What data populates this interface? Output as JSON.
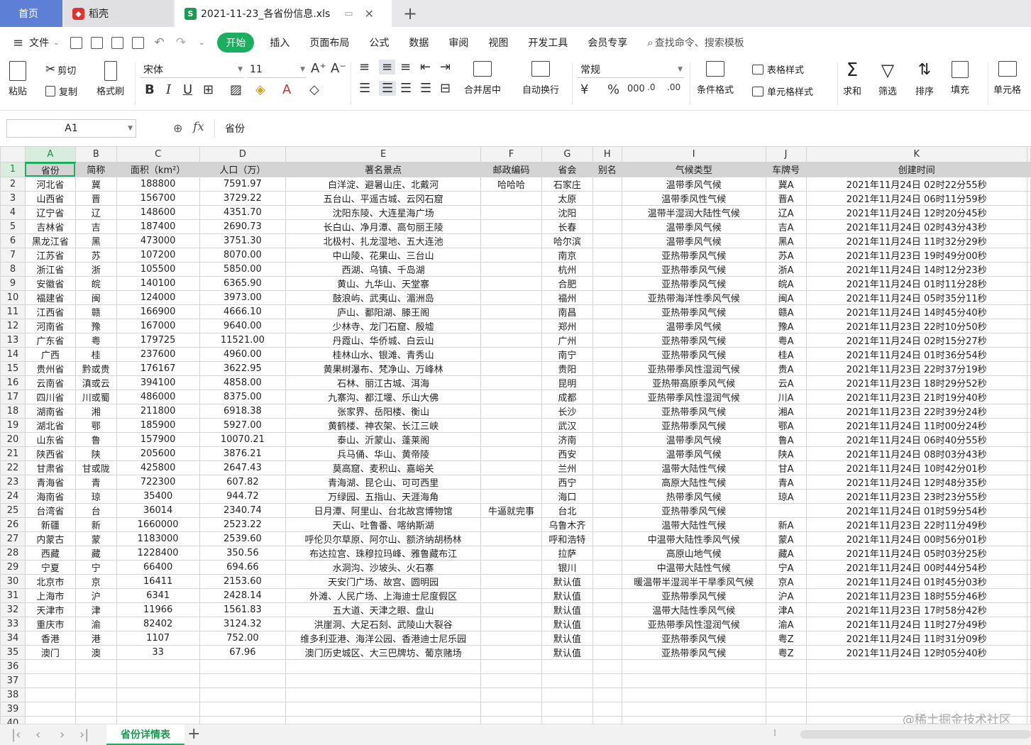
{
  "tabs": {
    "home": "首页",
    "daoke": "稻壳",
    "file": "2021-11-23_各省份信息.xls"
  },
  "menu": {
    "file": "文件",
    "items": [
      "开始",
      "插入",
      "页面布局",
      "公式",
      "数据",
      "审阅",
      "视图",
      "开发工具",
      "会员专享"
    ],
    "search": "查找命令、搜索模板"
  },
  "ribbon": {
    "paste": "粘贴",
    "cut": "剪切",
    "copy": "复制",
    "format_painter": "格式刷",
    "font_name": "宋体",
    "font_size": "11",
    "merge_center": "合并居中",
    "wrap": "自动换行",
    "number_format": "常规",
    "cond_format": "条件格式",
    "table_style": "表格样式",
    "cell_style": "单元格样式",
    "sum": "求和",
    "filter": "筛选",
    "sort": "排序",
    "fill": "填充",
    "cell": "单元格"
  },
  "formula": {
    "cell_ref": "A1",
    "fx": "fx",
    "content": "省份"
  },
  "columns": [
    "A",
    "B",
    "C",
    "D",
    "E",
    "F",
    "G",
    "H",
    "I",
    "J",
    "K"
  ],
  "header": [
    "省份",
    "简称",
    "面积（km²）",
    "人口（万）",
    "著名景点",
    "邮政编码",
    "省会",
    "别名",
    "气候类型",
    "车牌号",
    "创建时间"
  ],
  "rows": [
    [
      "河北省",
      "冀",
      "188800",
      "7591.97",
      "白洋淀、避暑山庄、北戴河",
      "哈哈哈",
      "石家庄",
      "",
      "温带季风气候",
      "冀A",
      "2021年11月24日 02时22分55秒"
    ],
    [
      "山西省",
      "晋",
      "156700",
      "3729.22",
      "五台山、平遥古城、云冈石窟",
      "",
      "太原",
      "",
      "温带季风性气候",
      "晋A",
      "2021年11月24日 06时11分59秒"
    ],
    [
      "辽宁省",
      "辽",
      "148600",
      "4351.70",
      "沈阳东陵、大连星海广场",
      "",
      "沈阳",
      "",
      "温带半湿润大陆性气候",
      "辽A",
      "2021年11月24日 12时20分45秒"
    ],
    [
      "吉林省",
      "吉",
      "187400",
      "2690.73",
      "长白山、净月潭、高句丽王陵",
      "",
      "长春",
      "",
      "温带季风气候",
      "吉A",
      "2021年11月24日 02时43分43秒"
    ],
    [
      "黑龙江省",
      "黑",
      "473000",
      "3751.30",
      "北极村、扎龙湿地、五大连池",
      "",
      "哈尔滨",
      "",
      "温带季风气候",
      "黑A",
      "2021年11月24日 11时32分29秒"
    ],
    [
      "江苏省",
      "苏",
      "107200",
      "8070.00",
      "中山陵、花果山、三台山",
      "",
      "南京",
      "",
      "亚热带季风气候",
      "苏A",
      "2021年11月23日 19时49分00秒"
    ],
    [
      "浙江省",
      "浙",
      "105500",
      "5850.00",
      "西湖、乌镇、千岛湖",
      "",
      "杭州",
      "",
      "亚热带季风气候",
      "浙A",
      "2021年11月24日 14时12分23秒"
    ],
    [
      "安徽省",
      "皖",
      "140100",
      "6365.90",
      "黄山、九华山、天堂寨",
      "",
      "合肥",
      "",
      "亚热带季风气候",
      "皖A",
      "2021年11月24日 01时11分28秒"
    ],
    [
      "福建省",
      "闽",
      "124000",
      "3973.00",
      "鼓浪屿、武夷山、湄洲岛",
      "",
      "福州",
      "",
      "亚热带海洋性季风气候",
      "闽A",
      "2021年11月24日 05时35分11秒"
    ],
    [
      "江西省",
      "赣",
      "166900",
      "4666.10",
      "庐山、鄱阳湖、滕王阁",
      "",
      "南昌",
      "",
      "亚热带季风气候",
      "赣A",
      "2021年11月24日 14时45分40秒"
    ],
    [
      "河南省",
      "豫",
      "167000",
      "9640.00",
      "少林寺、龙门石窟、殷墟",
      "",
      "郑州",
      "",
      "温带季风气候",
      "豫A",
      "2021年11月23日 22时10分50秒"
    ],
    [
      "广东省",
      "粤",
      "179725",
      "11521.00",
      "丹霞山、华侨城、白云山",
      "",
      "广州",
      "",
      "亚热带季风气候",
      "粤A",
      "2021年11月24日 02时15分27秒"
    ],
    [
      "广西",
      "桂",
      "237600",
      "4960.00",
      "桂林山水、银滩、青秀山",
      "",
      "南宁",
      "",
      "亚热带季风气候",
      "桂A",
      "2021年11月24日 01时36分54秒"
    ],
    [
      "贵州省",
      "黔或贵",
      "176167",
      "3622.95",
      "黄果树瀑布、梵净山、万峰林",
      "",
      "贵阳",
      "",
      "亚热带季风性湿润气候",
      "贵A",
      "2021年11月23日 22时37分19秒"
    ],
    [
      "云南省",
      "滇或云",
      "394100",
      "4858.00",
      "石林、丽江古城、洱海",
      "",
      "昆明",
      "",
      "亚热带高原季风气候",
      "云A",
      "2021年11月23日 18时29分52秒"
    ],
    [
      "四川省",
      "川或蜀",
      "486000",
      "8375.00",
      "九寨沟、都江堰、乐山大佛",
      "",
      "成都",
      "",
      "亚热带季风性湿润气候",
      "川A",
      "2021年11月23日 21时19分40秒"
    ],
    [
      "湖南省",
      "湘",
      "211800",
      "6918.38",
      "张家界、岳阳楼、衡山",
      "",
      "长沙",
      "",
      "亚热带季风气候",
      "湘A",
      "2021年11月23日 22时39分24秒"
    ],
    [
      "湖北省",
      "鄂",
      "185900",
      "5927.00",
      "黄鹤楼、神农架、长江三峡",
      "",
      "武汉",
      "",
      "亚热带季风气候",
      "鄂A",
      "2021年11月24日 11时00分24秒"
    ],
    [
      "山东省",
      "鲁",
      "157900",
      "10070.21",
      "泰山、沂蒙山、蓬莱阁",
      "",
      "济南",
      "",
      "温带季风气候",
      "鲁A",
      "2021年11月24日 06时40分55秒"
    ],
    [
      "陕西省",
      "陕",
      "205600",
      "3876.21",
      "兵马俑、华山、黄帝陵",
      "",
      "西安",
      "",
      "温带季风气候",
      "陕A",
      "2021年11月24日 08时03分43秒"
    ],
    [
      "甘肃省",
      "甘或陇",
      "425800",
      "2647.43",
      "莫高窟、麦积山、嘉峪关",
      "",
      "兰州",
      "",
      "温带大陆性气候",
      "甘A",
      "2021年11月24日 10时42分01秒"
    ],
    [
      "青海省",
      "青",
      "722300",
      "607.82",
      "青海湖、昆仑山、可可西里",
      "",
      "西宁",
      "",
      "高原大陆性气候",
      "青A",
      "2021年11月24日 12时48分35秒"
    ],
    [
      "海南省",
      "琼",
      "35400",
      "944.72",
      "万绿园、五指山、天涯海角",
      "",
      "海口",
      "",
      "热带季风气候",
      "琼A",
      "2021年11月23日 23时23分55秒"
    ],
    [
      "台湾省",
      "台",
      "36014",
      "2340.74",
      "日月潭、阿里山、台北故宫博物馆",
      "牛逼就完事",
      "台北",
      "",
      "亚热带季风气候",
      "",
      "2021年11月24日 01时59分54秒"
    ],
    [
      "新疆",
      "新",
      "1660000",
      "2523.22",
      "天山、吐鲁番、喀纳斯湖",
      "",
      "乌鲁木齐",
      "",
      "温带大陆性气候",
      "新A",
      "2021年11月23日 22时11分49秒"
    ],
    [
      "内蒙古",
      "蒙",
      "1183000",
      "2539.60",
      "呼伦贝尔草原、阿尔山、额济纳胡杨林",
      "",
      "呼和浩特",
      "",
      "中温带大陆性季风气候",
      "蒙A",
      "2021年11月24日 00时56分01秒"
    ],
    [
      "西藏",
      "藏",
      "1228400",
      "350.56",
      "布达拉宫、珠穆拉玛峰、雅鲁藏布江",
      "",
      "拉萨",
      "",
      "高原山地气候",
      "藏A",
      "2021年11月24日 05时03分25秒"
    ],
    [
      "宁夏",
      "宁",
      "66400",
      "694.66",
      "水洞沟、沙坡头、火石寨",
      "",
      "银川",
      "",
      "中温带大陆性气候",
      "宁A",
      "2021年11月24日 00时44分54秒"
    ],
    [
      "北京市",
      "京",
      "16411",
      "2153.60",
      "天安门广场、故宫、圆明园",
      "",
      "默认值",
      "",
      "暖温带半湿润半干旱季风气候",
      "京A",
      "2021年11月24日 01时45分03秒"
    ],
    [
      "上海市",
      "沪",
      "6341",
      "2428.14",
      "外滩、人民广场、上海迪士尼度假区",
      "",
      "默认值",
      "",
      "亚热带季风气候",
      "沪A",
      "2021年11月23日 18时55分46秒"
    ],
    [
      "天津市",
      "津",
      "11966",
      "1561.83",
      "五大道、天津之眼、盘山",
      "",
      "默认值",
      "",
      "温带大陆性季风气候",
      "津A",
      "2021年11月23日 17时58分42秒"
    ],
    [
      "重庆市",
      "渝",
      "82402",
      "3124.32",
      "洪崖洞、大足石刻、武陵山大裂谷",
      "",
      "默认值",
      "",
      "亚热带季风性湿润气候",
      "渝A",
      "2021年11月24日 11时27分49秒"
    ],
    [
      "香港",
      "港",
      "1107",
      "752.00",
      "维多利亚港、海洋公园、香港迪士尼乐园",
      "",
      "默认值",
      "",
      "亚热带季风气候",
      "粤Z",
      "2021年11月24日 11时31分09秒"
    ],
    [
      "澳门",
      "澳",
      "33",
      "67.96",
      "澳门历史城区、大三巴牌坊、葡京赌场",
      "",
      "默认值",
      "",
      "亚热带季风气候",
      "粤Z",
      "2021年11月24日 12时05分40秒"
    ]
  ],
  "row_numbers": [
    "1",
    "2",
    "3",
    "4",
    "5",
    "6",
    "7",
    "8",
    "9",
    "10",
    "11",
    "12",
    "13",
    "14",
    "15",
    "16",
    "17",
    "18",
    "19",
    "20",
    "21",
    "22",
    "23",
    "24",
    "25",
    "26",
    "27",
    "28",
    "29",
    "30",
    "31",
    "32",
    "33",
    "34",
    "35",
    "36",
    "37",
    "38",
    "39",
    "40"
  ],
  "sheet": {
    "tab_name": "省份详情表"
  },
  "watermark": "@稀土掘金技术社区",
  "colors": {
    "accent": "#1aae5e",
    "home_tab": "#5d7fd6",
    "header_row_bg": "#d4d4d4"
  }
}
